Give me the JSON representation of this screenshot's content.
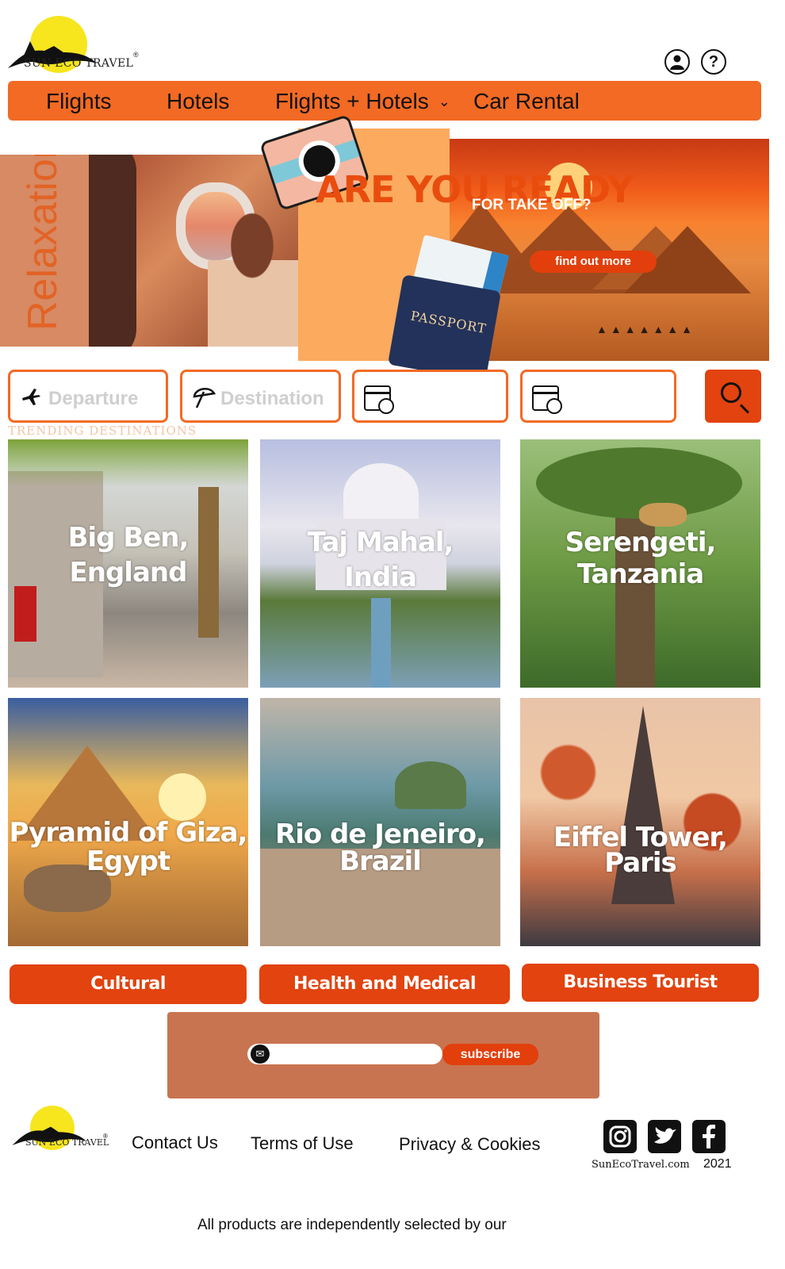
{
  "brand": {
    "name": "SUN ECO TRAVEL",
    "reg_mark": "®",
    "sun_color": "#f7e51e"
  },
  "header_icons": [
    {
      "name": "user-icon"
    },
    {
      "name": "help-icon",
      "glyph": "?"
    }
  ],
  "nav": {
    "items": [
      "Flights",
      "Hotels",
      "Flights + Hotels",
      "Car Rental"
    ],
    "dropdown_glyph": "⌄",
    "color": "#f26a24"
  },
  "hero": {
    "side_label": "Relaxation",
    "headline": "ARE YOU READY",
    "subheadline": "FOR TAKE OFF?",
    "cta": "find out more",
    "passport_text": "PASSPORT"
  },
  "search": {
    "departure_placeholder": "Departure",
    "destination_placeholder": "Destination",
    "accent": "#f26a24",
    "button_color": "#e2430f"
  },
  "trending_label": "TRENDING DESTINATIONS",
  "destinations": [
    {
      "line1": "Big Ben,",
      "line2": "England"
    },
    {
      "line1": "Taj Mahal,",
      "line2": "India"
    },
    {
      "line1": "Serengeti,",
      "line2": "Tanzania"
    },
    {
      "line1": "Pyramid of Giza,",
      "line2": "Egypt"
    },
    {
      "line1": "Rio de Jeneiro,",
      "line2": "Brazil"
    },
    {
      "line1": "Eiffel Tower,",
      "line2": "Paris"
    }
  ],
  "categories": [
    "Cultural",
    "Health and Medical",
    "Business Tourist"
  ],
  "subscribe": {
    "button": "subscribe",
    "icon": "envelope-icon"
  },
  "footer": {
    "links": [
      "Contact Us",
      "Terms of Use",
      "Privacy & Cookies"
    ],
    "social": [
      "instagram-icon",
      "twitter-icon",
      "facebook-icon"
    ],
    "site": "SunEcoTravel.com",
    "year": "2021",
    "disclaimer": "All products are independently selected by our"
  }
}
